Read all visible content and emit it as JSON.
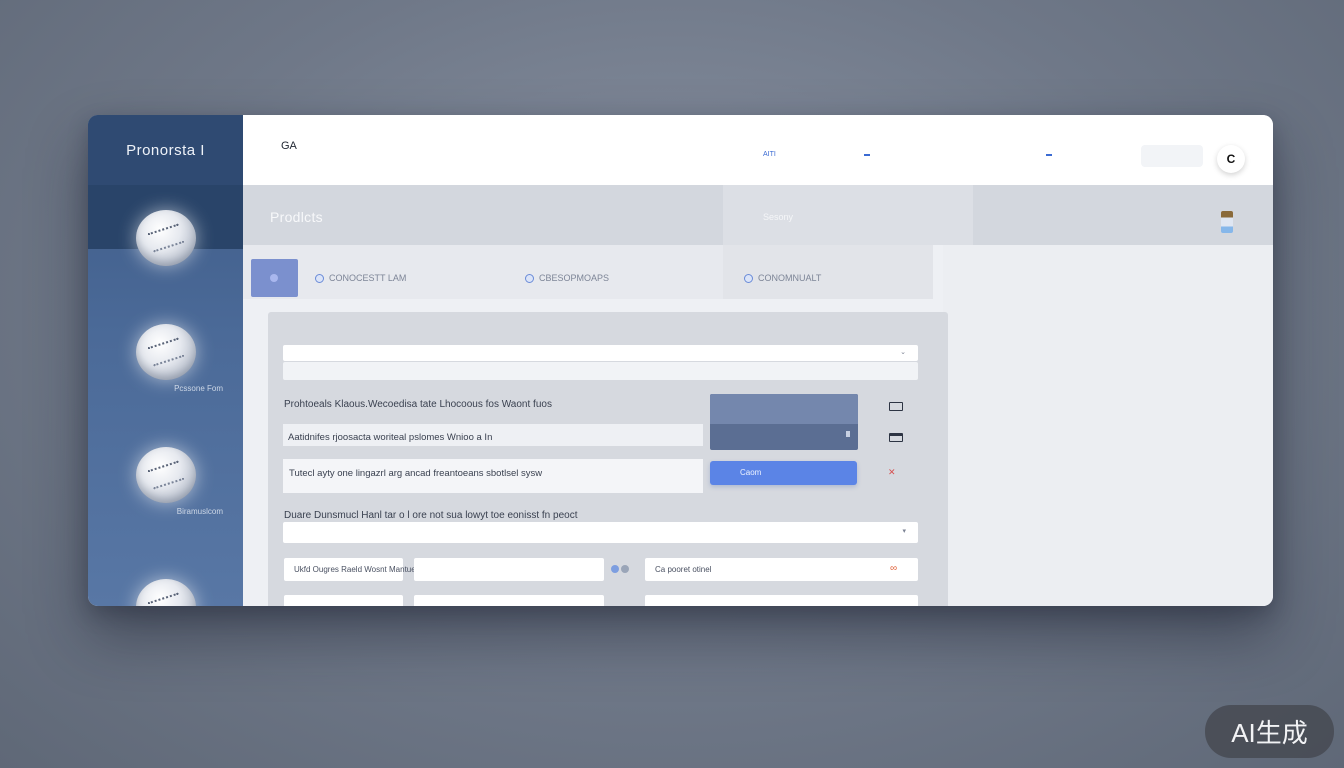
{
  "sidebar": {
    "brand": "Pronorsta I",
    "items": [
      {
        "label_left": "",
        "label_right": "",
        "sub": ""
      },
      {
        "label_left": "",
        "label_right": "Pcssone Fom",
        "sub": ""
      },
      {
        "label_left": "",
        "label_right": "Biramuslcom",
        "sub": ""
      },
      {
        "label_left": "",
        "label_right": "",
        "sub": ""
      }
    ]
  },
  "header": {
    "logo_line1": "GA",
    "logo_line2": "",
    "nav": [
      "AITI",
      "",
      "",
      "",
      "",
      "",
      ""
    ],
    "user_chip": "",
    "avatar_glyph": "C"
  },
  "titlebar": {
    "title": "Prodlcts",
    "center_label": "Sesony"
  },
  "tabs": [
    {
      "label": "CONOCESTT LAM"
    },
    {
      "label": "CBESOPMOAPS"
    },
    {
      "label": "CONOMNUALT"
    }
  ],
  "panel": {
    "title": "",
    "search_placeholder": "",
    "search_subline": "",
    "rows": [
      "Prohtoeals Klaous.Wecoedisa tate Lhocoous fos Waont fuos",
      "Aatidnifes rjoosacta woriteal pslomes Wnioo a In",
      "Tutecl ayty one lingazrl arg ancad freantoeans sbotlsel sysw",
      "Duare Dunsmucl Hanl tar o l ore not sua lowyt toe eonisst fn peoct"
    ],
    "dropdown_head": "",
    "button_left": "Caom",
    "button_right": "",
    "select_placeholder": "",
    "chips": [
      "Ukfd Ougres Raeld Wosnt Mantue Lacpehcre",
      "",
      "Ca pooret otinel",
      "",
      "",
      ""
    ]
  },
  "watermark": "AI生成",
  "colors": {
    "accent": "#5b84e6",
    "sidebar": "#3d5a86",
    "brand_bg": "#2f4a72"
  }
}
